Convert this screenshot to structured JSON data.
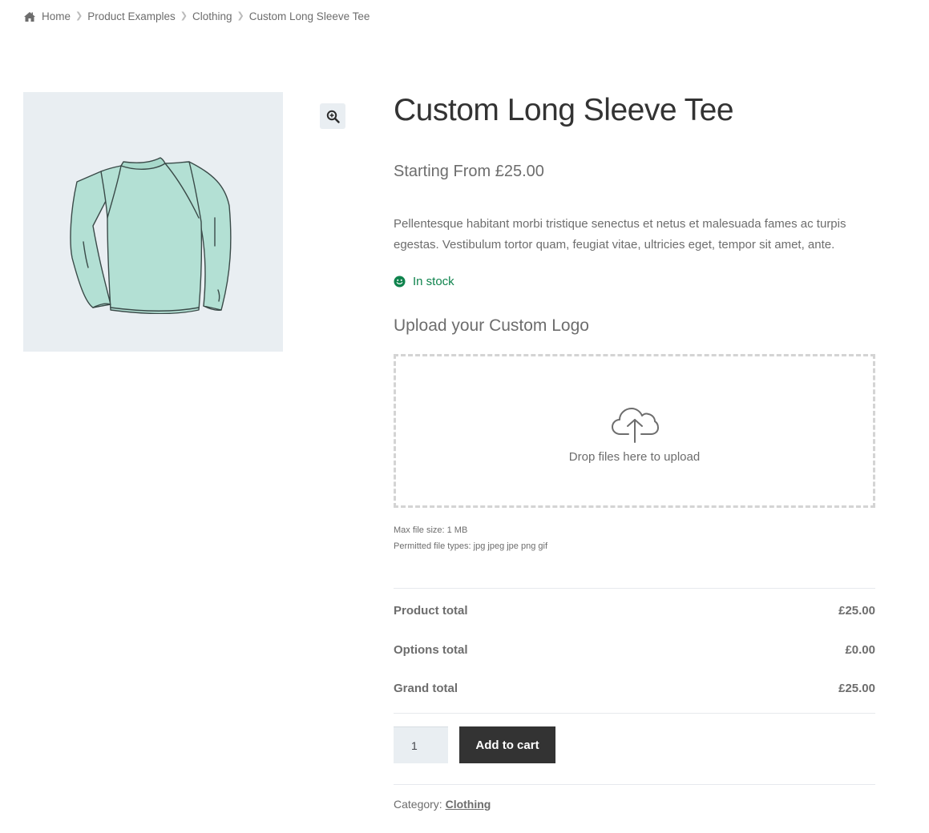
{
  "breadcrumb": {
    "items": [
      "Home",
      "Product Examples",
      "Clothing",
      "Custom Long Sleeve Tee"
    ]
  },
  "gallery": {
    "image_alt": "Custom Long Sleeve Tee - mint green long sleeve shirt illustration",
    "image_bg": "#e9eef2",
    "shirt_color": "#b3e0d4",
    "zoom_icon": "magnifier-plus-icon"
  },
  "product": {
    "title": "Custom Long Sleeve Tee",
    "price": "Starting From £25.00",
    "description": "Pellentesque habitant morbi tristique senectus et netus et malesuada fames ac turpis egestas. Vestibulum tortor quam, feugiat vitae, ultricies eget, tempor sit amet, ante.",
    "stock": "In stock",
    "stock_color": "#0f834d"
  },
  "upload": {
    "heading": "Upload your Custom Logo",
    "drop_text": "Drop files here to upload",
    "max_size": "Max file size: 1 MB",
    "permitted_types": "Permitted file types: jpg jpeg jpe png gif"
  },
  "totals": {
    "rows": [
      {
        "label": "Product total",
        "value": "£25.00"
      },
      {
        "label": "Options total",
        "value": "£0.00"
      },
      {
        "label": "Grand total",
        "value": "£25.00"
      }
    ]
  },
  "cart": {
    "quantity": "1",
    "add_to_cart_label": "Add to cart",
    "button_color": "#333333"
  },
  "meta": {
    "category_label": "Category:",
    "category_value": "Clothing"
  }
}
